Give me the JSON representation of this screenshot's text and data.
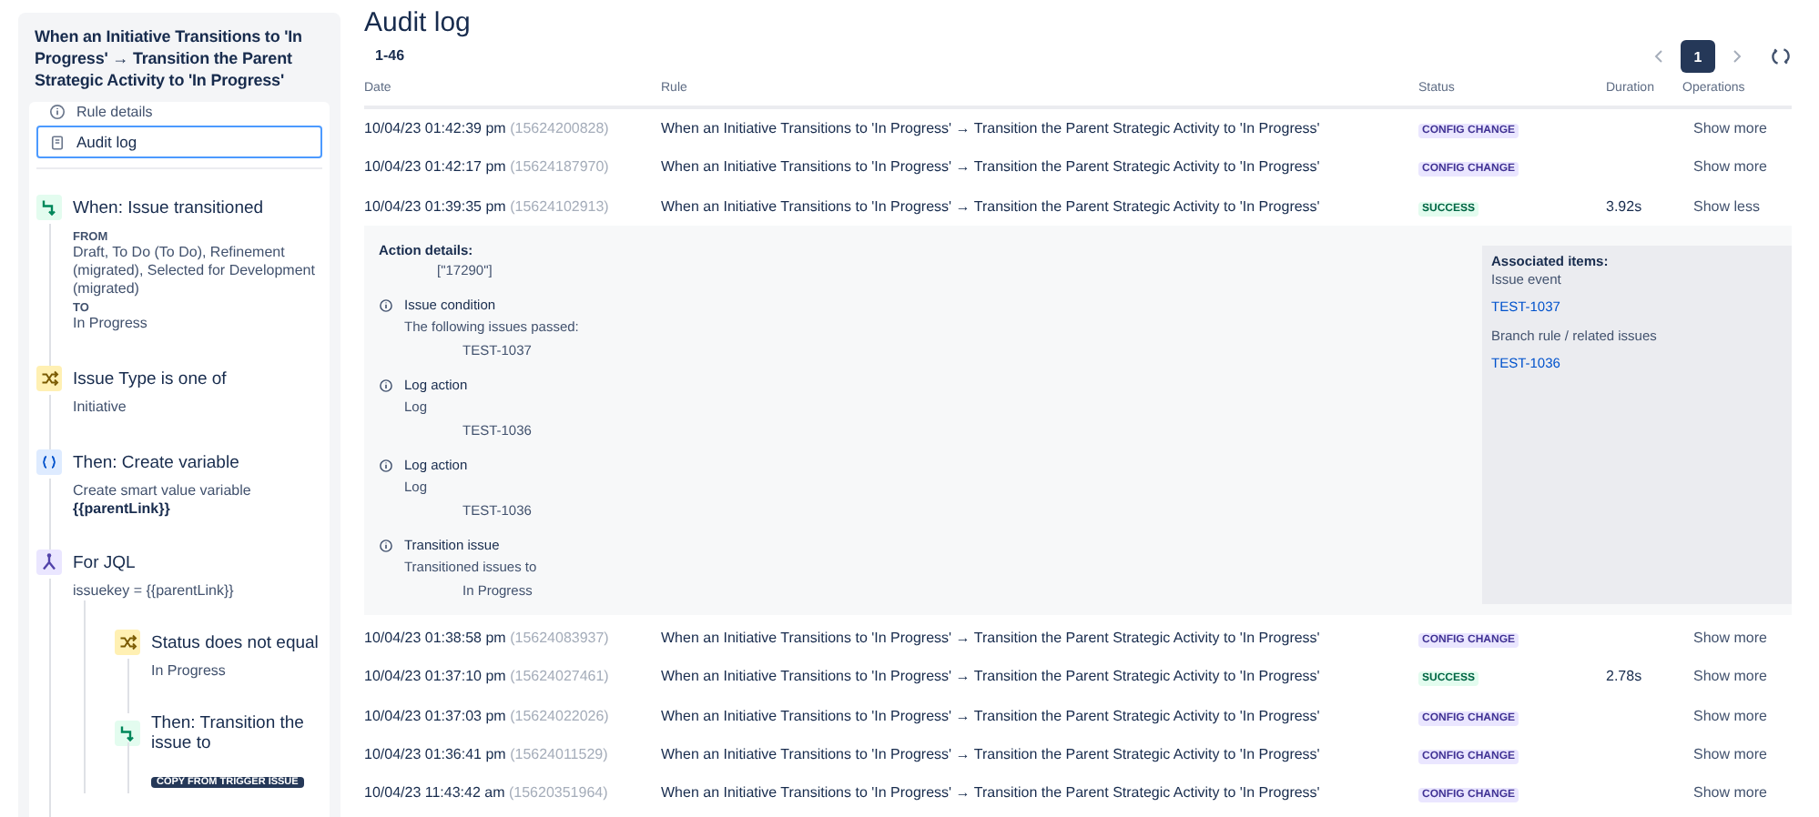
{
  "sidebar": {
    "title": "When an Initiative Transitions to 'In Progress' → Transition the Parent Strategic Activity to 'In Progress'",
    "nav": [
      {
        "label": "Rule details",
        "kind": "info",
        "selected": false
      },
      {
        "label": "Audit log",
        "kind": "log",
        "selected": true
      }
    ],
    "steps": [
      {
        "kind": "trigger",
        "title": "When: Issue transitioned",
        "lines": [
          {
            "kind": "label",
            "text": "FROM"
          },
          {
            "kind": "text",
            "text": "Draft, To Do (To Do), Refinement (migrated), Selected for Development (migrated)"
          },
          {
            "kind": "label",
            "text": "TO"
          },
          {
            "kind": "text",
            "text": "In Progress"
          }
        ]
      },
      {
        "kind": "condition",
        "title": "Issue Type is one of",
        "lines": [
          {
            "kind": "text",
            "text": "Initiative"
          }
        ]
      },
      {
        "kind": "variable",
        "title": "Then: Create variable",
        "lines": [
          {
            "kind": "text",
            "text": "Create smart value variable"
          },
          {
            "kind": "code",
            "text": "{{parentLink}}"
          }
        ]
      },
      {
        "kind": "branch",
        "title": "For JQL",
        "lines": [
          {
            "kind": "text",
            "text": "issuekey = {{parentLink}}"
          }
        ],
        "children": [
          {
            "kind": "condition",
            "title": "Status does not equal",
            "lines": [
              {
                "kind": "text",
                "text": "In Progress"
              }
            ]
          },
          {
            "kind": "trigger",
            "title": "Then: Transition the issue to",
            "lines": [
              {
                "kind": "lozenge",
                "text": "COPY FROM TRIGGER ISSUE"
              }
            ]
          }
        ]
      }
    ]
  },
  "header": {
    "title": "Audit log",
    "count": "1-46"
  },
  "pagination": {
    "pages": [
      {
        "label": "1",
        "selected": true
      }
    ]
  },
  "table": {
    "columns": [
      "Date",
      "Rule",
      "Status",
      "Duration",
      "Operations"
    ],
    "rows": [
      {
        "date": "10/04/23 01:42:39 pm",
        "id": "(15624200828)",
        "rule": "When an Initiative Transitions to 'In Progress' → Transition the Parent Strategic Activity to 'In Progress'",
        "status": {
          "label": "CONFIG CHANGE",
          "kind": "config"
        },
        "operation": "Show more",
        "expanded": false
      },
      {
        "date": "10/04/23 01:42:17 pm",
        "id": "(15624187970)",
        "rule": "When an Initiative Transitions to 'In Progress' → Transition the Parent Strategic Activity to 'In Progress'",
        "status": {
          "label": "CONFIG CHANGE",
          "kind": "config"
        },
        "operation": "Show more",
        "expanded": false
      },
      {
        "date": "10/04/23 01:39:35 pm",
        "id": "(15624102913)",
        "rule": "When an Initiative Transitions to 'In Progress' → Transition the Parent Strategic Activity to 'In Progress'",
        "status": {
          "label": "SUCCESS",
          "kind": "success"
        },
        "duration": "3.92s",
        "operation": "Show less",
        "expanded": true
      },
      {
        "date": "10/04/23 01:38:58 pm",
        "id": "(15624083937)",
        "rule": "When an Initiative Transitions to 'In Progress' → Transition the Parent Strategic Activity to 'In Progress'",
        "status": {
          "label": "CONFIG CHANGE",
          "kind": "config"
        },
        "operation": "Show more",
        "expanded": false
      },
      {
        "date": "10/04/23 01:37:10 pm",
        "id": "(15624027461)",
        "rule": "When an Initiative Transitions to 'In Progress' → Transition the Parent Strategic Activity to 'In Progress'",
        "status": {
          "label": "SUCCESS",
          "kind": "success"
        },
        "duration": "2.78s",
        "operation": "Show more",
        "expanded": false
      },
      {
        "date": "10/04/23 01:37:03 pm",
        "id": "(15624022026)",
        "rule": "When an Initiative Transitions to 'In Progress' → Transition the Parent Strategic Activity to 'In Progress'",
        "status": {
          "label": "CONFIG CHANGE",
          "kind": "config"
        },
        "operation": "Show more",
        "expanded": false
      },
      {
        "date": "10/04/23 01:36:41 pm",
        "id": "(15624011529)",
        "rule": "When an Initiative Transitions to 'In Progress' → Transition the Parent Strategic Activity to 'In Progress'",
        "status": {
          "label": "CONFIG CHANGE",
          "kind": "config"
        },
        "operation": "Show more",
        "expanded": false
      },
      {
        "date": "10/04/23 11:43:42 am",
        "id": "(15620351964)",
        "rule": "When an Initiative Transitions to 'In Progress' → Transition the Parent Strategic Activity to 'In Progress'",
        "status": {
          "label": "CONFIG CHANGE",
          "kind": "config"
        },
        "operation": "Show more",
        "expanded": false
      }
    ]
  },
  "details": {
    "heading": "Action details:",
    "value": "[\"17290\"]",
    "entries": [
      {
        "title": "Issue condition",
        "description": "The following issues passed:",
        "value": "TEST-1037"
      },
      {
        "title": "Log action",
        "description": "Log",
        "value": "TEST-1036"
      },
      {
        "title": "Log action",
        "description": "Log",
        "value": "TEST-1036"
      },
      {
        "title": "Transition issue",
        "description": "Transitioned issues to",
        "value": "In Progress"
      }
    ],
    "associated": {
      "heading": "Associated items:",
      "groups": [
        {
          "label": "Issue event",
          "links": [
            "TEST-1037"
          ]
        },
        {
          "label": "Branch rule / related issues",
          "links": [
            "TEST-1036"
          ]
        }
      ]
    }
  }
}
